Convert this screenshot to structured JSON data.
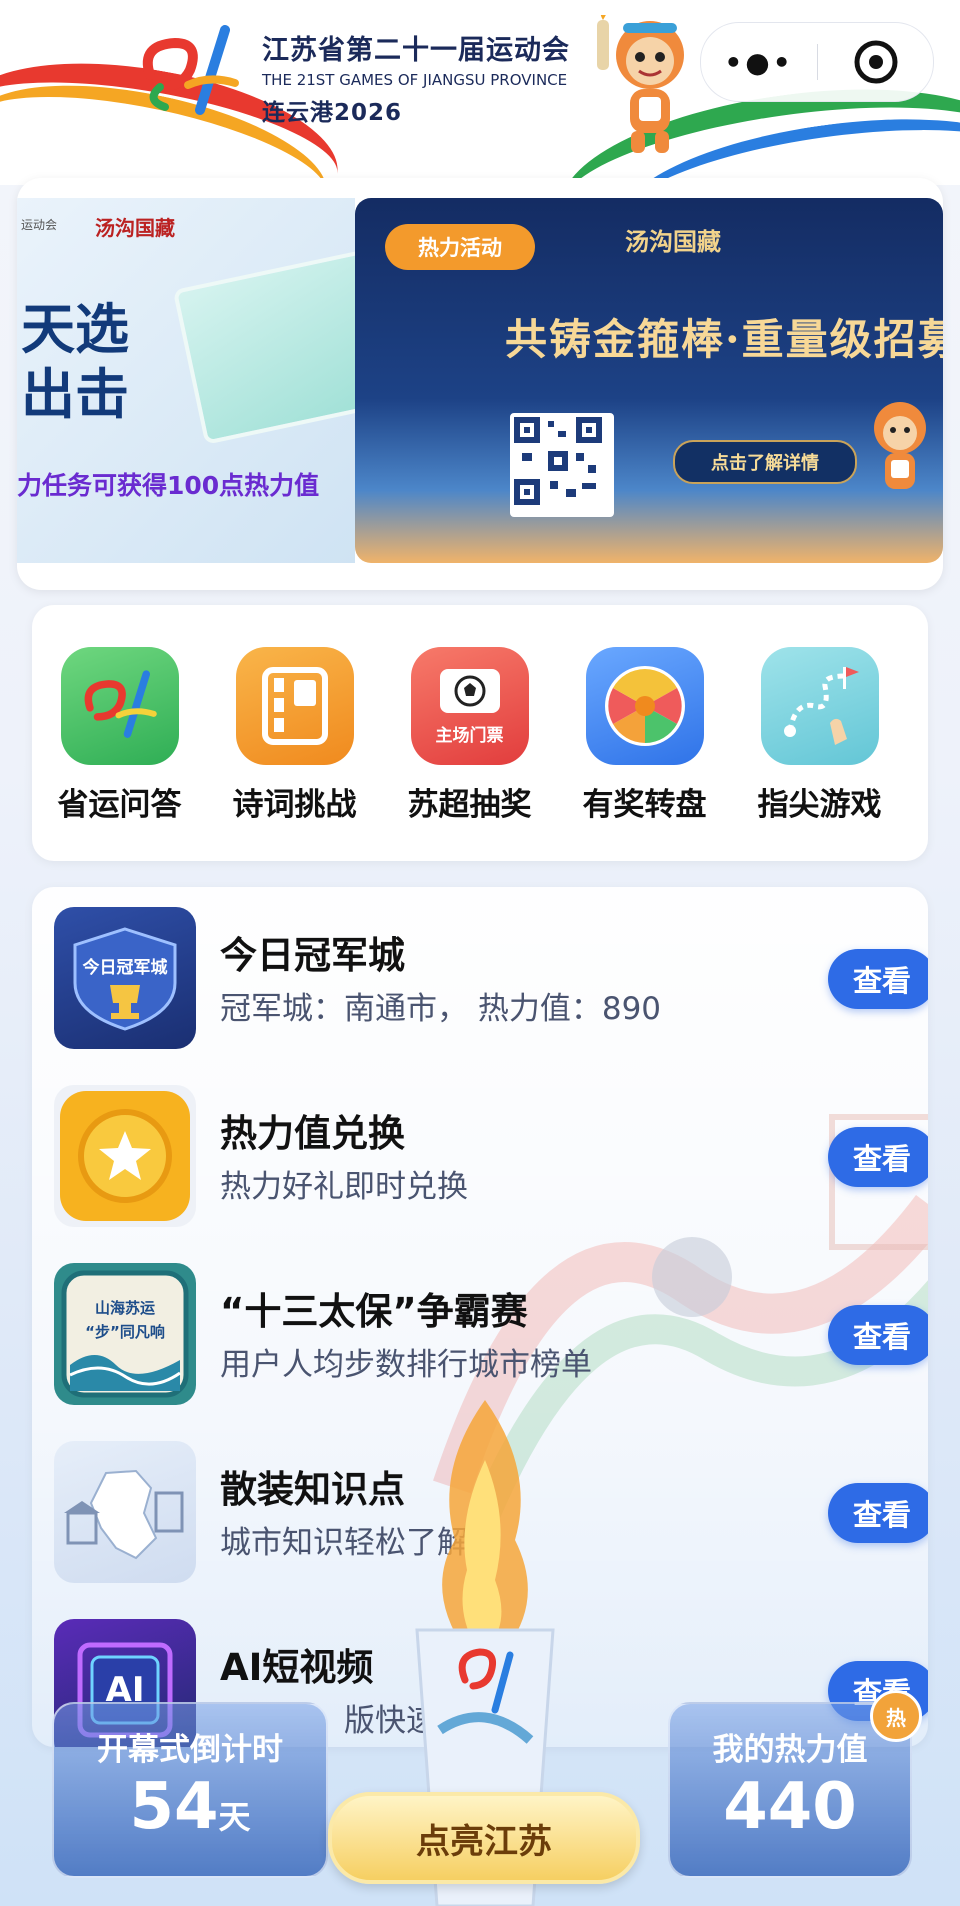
{
  "header": {
    "title_cn": "江苏省第二十一届运动会",
    "title_en": "THE 21ST GAMES OF JIANGSU PROVINCE",
    "city_year": "连云港2026",
    "more_icon": "more-dots-icon",
    "close_icon": "target-circle-icon"
  },
  "banner": {
    "left_slide": {
      "brand_small": "运动会",
      "brand": "汤沟国藏",
      "headline": "天选\n出击",
      "task_text": "力任务可获得100点热力值"
    },
    "right_slide": {
      "tag": "热力活动",
      "brand": "汤沟国藏",
      "headline": "共铸金箍棒·重量级招募",
      "button": "点击了解详情"
    }
  },
  "grid": [
    {
      "label": "省运问答",
      "icon": "games-logo-icon",
      "color": "#4cc36b"
    },
    {
      "label": "诗词挑战",
      "icon": "notebook-icon",
      "color": "#f4a23a"
    },
    {
      "label": "苏超抽奖",
      "icon": "ticket-icon",
      "color": "#ef5b5b",
      "icon_text": "主场门票"
    },
    {
      "label": "有奖转盘",
      "icon": "wheel-icon",
      "color": "#4b8ff2"
    },
    {
      "label": "指尖游戏",
      "icon": "map-path-icon",
      "color": "#7fd1dc"
    }
  ],
  "list": [
    {
      "title": "今日冠军城",
      "sub": "冠军城：南通市， 热力值：890",
      "button": "查看",
      "icon": "champion-city-icon",
      "icon_text": "今日冠军城"
    },
    {
      "title": "热力值兑换",
      "sub": "热力好礼即时兑换",
      "button": "查看",
      "icon": "gold-coin-star-icon"
    },
    {
      "title": "“十三太保”争霸赛",
      "sub": "用户人均步数排行城市榜单",
      "button": "查看",
      "icon": "wave-badge-icon",
      "icon_text": "山海苏运“步”同凡响"
    },
    {
      "title": "散装知识点",
      "sub": "城市知识轻松了解",
      "button": "查看",
      "icon": "map-knowledge-icon"
    },
    {
      "title": "AI短视频",
      "sub": "版快速生成",
      "button": "查看",
      "icon": "ai-chip-icon",
      "icon_text": "AI"
    }
  ],
  "bottom": {
    "countdown_label": "开幕式倒计时",
    "countdown_value": "54",
    "countdown_unit": "天",
    "light_button": "点亮江苏",
    "heat_label": "我的热力值",
    "heat_value": "440",
    "hot_badge": "热"
  }
}
